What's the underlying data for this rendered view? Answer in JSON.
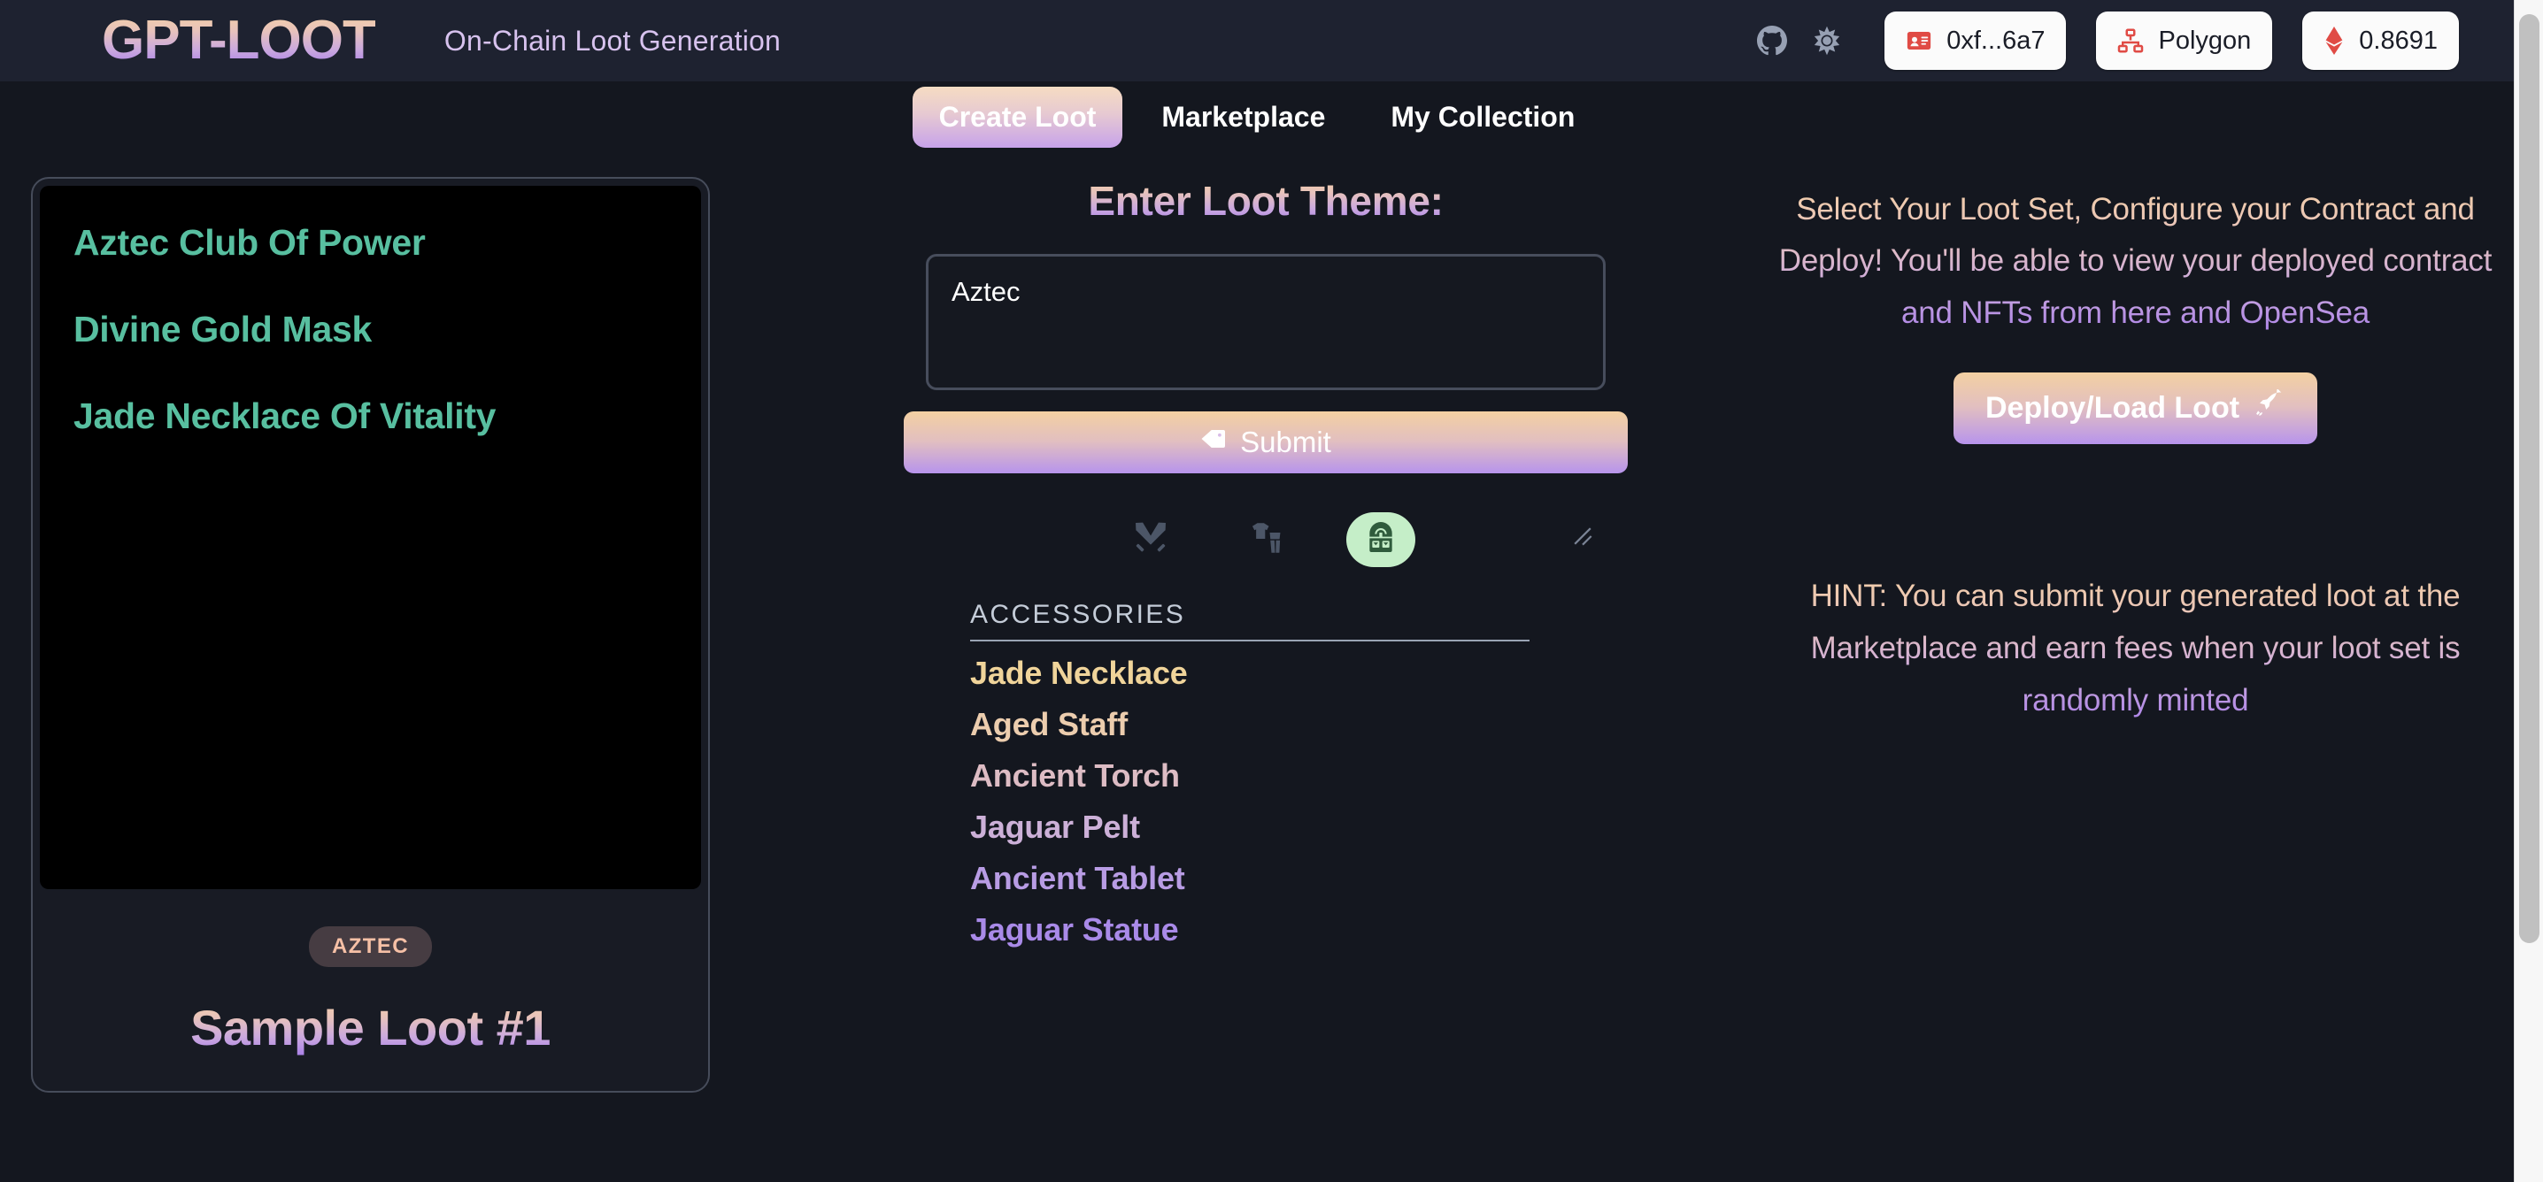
{
  "header": {
    "logo": "GPT-LOOT",
    "tagline": "On-Chain Loot Generation",
    "github_icon": "github-icon",
    "theme_icon": "sun-icon",
    "buttons": [
      {
        "icon": "id-card-icon",
        "label": "0xf...6a7"
      },
      {
        "icon": "network-sitemap-icon",
        "label": "Polygon"
      },
      {
        "icon": "ethereum-diamond-icon",
        "label": "0.8691"
      }
    ]
  },
  "tabs": [
    {
      "label": "Create Loot",
      "active": true
    },
    {
      "label": "Marketplace",
      "active": false
    },
    {
      "label": "My Collection",
      "active": false
    }
  ],
  "loot_card": {
    "items": [
      "Aztec Club Of Power",
      "Divine Gold Mask",
      "Jade Necklace Of Vitality"
    ],
    "badge": "AZTEC",
    "title": "Sample Loot #1",
    "item_color": "#58bfa0",
    "canvas_color": "#000000"
  },
  "create": {
    "label": "Enter Loot Theme:",
    "input_value": "Aztec",
    "input_placeholder": "",
    "submit_label": "Submit",
    "submit_icon": "tag-icon",
    "categories": [
      {
        "name": "weapons",
        "icon": "crossed-swords-icon",
        "selected": false
      },
      {
        "name": "clothing",
        "icon": "clothes-icon",
        "selected": false
      },
      {
        "name": "accessories",
        "icon": "backpack-icon",
        "selected": true
      }
    ],
    "accessories_title": "ACCESSORIES",
    "accessories": [
      {
        "label": "Jade Necklace",
        "color": "#f0d49a"
      },
      {
        "label": "Aged Staff",
        "color": "#eccdae"
      },
      {
        "label": "Ancient Torch",
        "color": "#ddbcc4"
      },
      {
        "label": "Jaguar Pelt",
        "color": "#ccb0d8"
      },
      {
        "label": "Ancient Tablet",
        "color": "#b89ce4"
      },
      {
        "label": "Jaguar Statue",
        "color": "#a98ae8"
      }
    ]
  },
  "deploy": {
    "description": "Select Your Loot Set, Configure your Contract and Deploy! You'll be able to view your deployed contract and NFTs from here and OpenSea",
    "button_label": "Deploy/Load Loot",
    "button_icon": "rocket-icon",
    "hint": "HINT: You can submit your generated loot at the Marketplace and earn fees when your loot set is randomly minted"
  },
  "colors": {
    "background": "#14171f",
    "header_background": "#1e2230",
    "gradient_start": "#f3cfa8",
    "gradient_end": "#a97fe8",
    "accent_red": "#e04b45",
    "selected_green_bg": "#c5eec8"
  }
}
